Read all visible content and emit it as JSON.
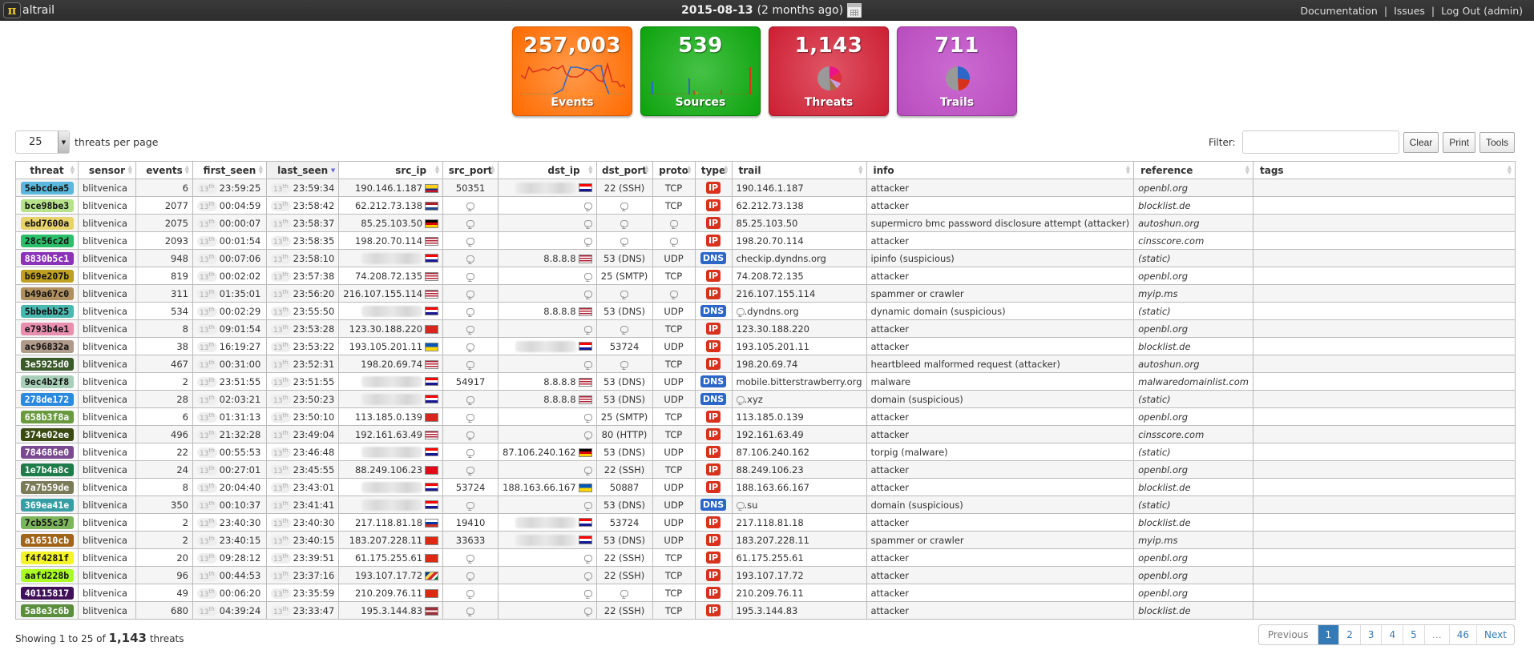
{
  "topbar": {
    "logo_text": "altrail",
    "date": "2015-08-13",
    "date_relative": "(2 months ago)",
    "links": [
      "Documentation",
      "Issues",
      "Log Out (admin)"
    ]
  },
  "cards": [
    {
      "id": "events",
      "value": "257,003",
      "label": "Events",
      "color": "#ff7a1a"
    },
    {
      "id": "sources",
      "value": "539",
      "label": "Sources",
      "color": "#1aab1a"
    },
    {
      "id": "threats",
      "value": "1,143",
      "label": "Threats",
      "color": "#d42f40"
    },
    {
      "id": "trails",
      "value": "711",
      "label": "Trails",
      "color": "#c05cc6"
    }
  ],
  "controls": {
    "per_page_value": "25",
    "per_page_label": "threats per page",
    "filter_label": "Filter:",
    "filter_value": "",
    "clear_label": "Clear",
    "print_label": "Print",
    "tools_label": "Tools"
  },
  "table": {
    "columns": [
      "threat",
      "sensor",
      "events",
      "first_seen",
      "last_seen",
      "src_ip",
      "src_port",
      "dst_ip",
      "dst_port",
      "proto",
      "type",
      "trail",
      "info",
      "reference",
      "tags"
    ],
    "sorted_column": "last_seen",
    "rows": [
      {
        "threat": "5ebcdea5",
        "color": "#5bb8dc",
        "fg": "#111",
        "sensor": "blitvenica",
        "events": "6",
        "day": "13",
        "first": "23:59:25",
        "last": "23:59:34",
        "src_ip": "190.146.1.187",
        "src_flag": "co",
        "src_port": "50351",
        "dst_ip": "blurred",
        "dst_flag": "hr",
        "dst_port": "22 (SSH)",
        "proto": "TCP",
        "type": "IP",
        "trail": "190.146.1.187",
        "info": "attacker",
        "reference": "openbl.org"
      },
      {
        "threat": "bce98be3",
        "color": "#b6e28a",
        "fg": "#111",
        "sensor": "blitvenica",
        "events": "2077",
        "day": "13",
        "first": "00:04:59",
        "last": "23:58:42",
        "src_ip": "62.212.73.138",
        "src_flag": "nl",
        "src_port": "",
        "dst_ip": "",
        "dst_flag": "",
        "dst_port": "",
        "proto": "TCP",
        "type": "IP",
        "trail": "62.212.73.138",
        "info": "attacker",
        "reference": "blocklist.de"
      },
      {
        "threat": "ebd7600a",
        "color": "#e8d36a",
        "fg": "#111",
        "sensor": "blitvenica",
        "events": "2075",
        "day": "13",
        "first": "00:00:07",
        "last": "23:58:37",
        "src_ip": "85.25.103.50",
        "src_flag": "de",
        "src_port": "",
        "dst_ip": "",
        "dst_flag": "",
        "dst_port": "",
        "proto": "",
        "type": "IP",
        "trail": "85.25.103.50",
        "info": "supermicro bmc password disclosure attempt (attacker)",
        "reference": "autoshun.org"
      },
      {
        "threat": "28c56c2d",
        "color": "#2bbf6a",
        "fg": "#111",
        "sensor": "blitvenica",
        "events": "2093",
        "day": "13",
        "first": "00:01:54",
        "last": "23:58:35",
        "src_ip": "198.20.70.114",
        "src_flag": "us",
        "src_port": "",
        "dst_ip": "",
        "dst_flag": "",
        "dst_port": "",
        "proto": "",
        "type": "IP",
        "trail": "198.20.70.114",
        "info": "attacker",
        "reference": "cinsscore.com"
      },
      {
        "threat": "8830b5c1",
        "color": "#8a33b8",
        "fg": "#fff",
        "sensor": "blitvenica",
        "events": "948",
        "day": "13",
        "first": "00:07:06",
        "last": "23:58:10",
        "src_ip": "blurred",
        "src_flag": "hr",
        "src_port": "",
        "dst_ip": "8.8.8.8",
        "dst_flag": "us",
        "dst_port": "53 (DNS)",
        "proto": "UDP",
        "type": "DNS",
        "trail": "checkip.dyndns.org",
        "info": "ipinfo (suspicious)",
        "reference": "(static)"
      },
      {
        "threat": "b69e207b",
        "color": "#c0a020",
        "fg": "#111",
        "sensor": "blitvenica",
        "events": "819",
        "day": "13",
        "first": "00:02:02",
        "last": "23:57:38",
        "src_ip": "74.208.72.135",
        "src_flag": "us",
        "src_port": "",
        "dst_ip": "",
        "dst_flag": "",
        "dst_port": "25 (SMTP)",
        "proto": "TCP",
        "type": "IP",
        "trail": "74.208.72.135",
        "info": "attacker",
        "reference": "openbl.org"
      },
      {
        "threat": "b49a67c0",
        "color": "#b09060",
        "fg": "#111",
        "sensor": "blitvenica",
        "events": "311",
        "day": "13",
        "first": "01:35:01",
        "last": "23:56:20",
        "src_ip": "216.107.155.114",
        "src_flag": "us",
        "src_port": "",
        "dst_ip": "",
        "dst_flag": "",
        "dst_port": "",
        "proto": "",
        "type": "IP",
        "trail": "216.107.155.114",
        "info": "spammer or crawler",
        "reference": "myip.ms"
      },
      {
        "threat": "5bbebb25",
        "color": "#4ab8b0",
        "fg": "#111",
        "sensor": "blitvenica",
        "events": "534",
        "day": "13",
        "first": "00:02:29",
        "last": "23:55:50",
        "src_ip": "blurred",
        "src_flag": "hr",
        "src_port": "",
        "dst_ip": "8.8.8.8",
        "dst_flag": "us",
        "dst_port": "53 (DNS)",
        "proto": "UDP",
        "type": "DNS",
        "trail": "●.dyndns.org",
        "info": "dynamic domain (suspicious)",
        "reference": "(static)"
      },
      {
        "threat": "e793b4e1",
        "color": "#e88fb0",
        "fg": "#111",
        "sensor": "blitvenica",
        "events": "8",
        "day": "13",
        "first": "09:01:54",
        "last": "23:53:28",
        "src_ip": "123.30.188.220",
        "src_flag": "vn",
        "src_port": "",
        "dst_ip": "",
        "dst_flag": "",
        "dst_port": "",
        "proto": "TCP",
        "type": "IP",
        "trail": "123.30.188.220",
        "info": "attacker",
        "reference": "openbl.org"
      },
      {
        "threat": "ac96832a",
        "color": "#b09a8a",
        "fg": "#111",
        "sensor": "blitvenica",
        "events": "38",
        "day": "13",
        "first": "16:19:27",
        "last": "23:53:22",
        "src_ip": "193.105.201.11",
        "src_flag": "ua",
        "src_port": "",
        "dst_ip": "blurred",
        "dst_flag": "hr",
        "dst_port": "53724",
        "proto": "UDP",
        "type": "IP",
        "trail": "193.105.201.11",
        "info": "attacker",
        "reference": "blocklist.de"
      },
      {
        "threat": "3e5925d0",
        "color": "#3a5a2a",
        "fg": "#fff",
        "sensor": "blitvenica",
        "events": "467",
        "day": "13",
        "first": "00:31:00",
        "last": "23:52:31",
        "src_ip": "198.20.69.74",
        "src_flag": "us",
        "src_port": "",
        "dst_ip": "",
        "dst_flag": "",
        "dst_port": "",
        "proto": "TCP",
        "type": "IP",
        "trail": "198.20.69.74",
        "info": "heartbleed malformed request (attacker)",
        "reference": "autoshun.org"
      },
      {
        "threat": "9ec4b2f8",
        "color": "#a8d0b8",
        "fg": "#111",
        "sensor": "blitvenica",
        "events": "2",
        "day": "13",
        "first": "23:51:55",
        "last": "23:51:55",
        "src_ip": "blurred",
        "src_flag": "hr",
        "src_port": "54917",
        "dst_ip": "8.8.8.8",
        "dst_flag": "us",
        "dst_port": "53 (DNS)",
        "proto": "UDP",
        "type": "DNS",
        "trail": "mobile.bitterstrawberry.org",
        "info": "malware",
        "reference": "malwaredomainlist.com"
      },
      {
        "threat": "278de172",
        "color": "#2a8ae0",
        "fg": "#fff",
        "sensor": "blitvenica",
        "events": "28",
        "day": "13",
        "first": "02:03:21",
        "last": "23:50:23",
        "src_ip": "blurred",
        "src_flag": "hr",
        "src_port": "",
        "dst_ip": "8.8.8.8",
        "dst_flag": "us",
        "dst_port": "53 (DNS)",
        "proto": "UDP",
        "type": "DNS",
        "trail": "●.xyz",
        "info": "domain (suspicious)",
        "reference": "(static)"
      },
      {
        "threat": "658b3f8a",
        "color": "#6a9a40",
        "fg": "#fff",
        "sensor": "blitvenica",
        "events": "6",
        "day": "13",
        "first": "01:31:13",
        "last": "23:50:10",
        "src_ip": "113.185.0.139",
        "src_flag": "vn",
        "src_port": "",
        "dst_ip": "",
        "dst_flag": "",
        "dst_port": "25 (SMTP)",
        "proto": "TCP",
        "type": "IP",
        "trail": "113.185.0.139",
        "info": "attacker",
        "reference": "openbl.org"
      },
      {
        "threat": "374e02ee",
        "color": "#3a4a10",
        "fg": "#fff",
        "sensor": "blitvenica",
        "events": "496",
        "day": "13",
        "first": "21:32:28",
        "last": "23:49:04",
        "src_ip": "192.161.63.49",
        "src_flag": "us",
        "src_port": "",
        "dst_ip": "",
        "dst_flag": "",
        "dst_port": "80 (HTTP)",
        "proto": "TCP",
        "type": "IP",
        "trail": "192.161.63.49",
        "info": "attacker",
        "reference": "cinsscore.com"
      },
      {
        "threat": "784686e0",
        "color": "#7a4a90",
        "fg": "#fff",
        "sensor": "blitvenica",
        "events": "22",
        "day": "13",
        "first": "00:55:53",
        "last": "23:46:48",
        "src_ip": "blurred",
        "src_flag": "hr",
        "src_port": "",
        "dst_ip": "87.106.240.162",
        "dst_flag": "de",
        "dst_port": "53 (DNS)",
        "proto": "UDP",
        "type": "IP",
        "trail": "87.106.240.162",
        "info": "torpig (malware)",
        "reference": "(static)"
      },
      {
        "threat": "1e7b4a8c",
        "color": "#1e7b4a",
        "fg": "#fff",
        "sensor": "blitvenica",
        "events": "24",
        "day": "13",
        "first": "00:27:01",
        "last": "23:45:55",
        "src_ip": "88.249.106.23",
        "src_flag": "tr",
        "src_port": "",
        "dst_ip": "",
        "dst_flag": "",
        "dst_port": "22 (SSH)",
        "proto": "TCP",
        "type": "IP",
        "trail": "88.249.106.23",
        "info": "attacker",
        "reference": "openbl.org"
      },
      {
        "threat": "7a7b59de",
        "color": "#7a7b59",
        "fg": "#fff",
        "sensor": "blitvenica",
        "events": "8",
        "day": "13",
        "first": "20:04:40",
        "last": "23:43:01",
        "src_ip": "blurred",
        "src_flag": "hr",
        "src_port": "53724",
        "dst_ip": "188.163.66.167",
        "dst_flag": "ua",
        "dst_port": "50887",
        "proto": "UDP",
        "type": "IP",
        "trail": "188.163.66.167",
        "info": "attacker",
        "reference": "blocklist.de"
      },
      {
        "threat": "369ea41e",
        "color": "#369ea4",
        "fg": "#fff",
        "sensor": "blitvenica",
        "events": "350",
        "day": "13",
        "first": "00:10:37",
        "last": "23:41:41",
        "src_ip": "blurred",
        "src_flag": "hr",
        "src_port": "",
        "dst_ip": "",
        "dst_flag": "",
        "dst_port": "53 (DNS)",
        "proto": "UDP",
        "type": "DNS",
        "trail": "●.su",
        "info": "domain (suspicious)",
        "reference": "(static)"
      },
      {
        "threat": "7cb55c37",
        "color": "#7cb55c",
        "fg": "#111",
        "sensor": "blitvenica",
        "events": "2",
        "day": "13",
        "first": "23:40:30",
        "last": "23:40:30",
        "src_ip": "217.118.81.18",
        "src_flag": "ru",
        "src_port": "19410",
        "dst_ip": "blurred",
        "dst_flag": "hr",
        "dst_port": "53724",
        "proto": "UDP",
        "type": "IP",
        "trail": "217.118.81.18",
        "info": "attacker",
        "reference": "blocklist.de"
      },
      {
        "threat": "a16510cb",
        "color": "#a1651a",
        "fg": "#fff",
        "sensor": "blitvenica",
        "events": "2",
        "day": "13",
        "first": "23:40:15",
        "last": "23:40:15",
        "src_ip": "183.207.228.11",
        "src_flag": "cn",
        "src_port": "33633",
        "dst_ip": "blurred",
        "dst_flag": "hr",
        "dst_port": "53 (DNS)",
        "proto": "UDP",
        "type": "IP",
        "trail": "183.207.228.11",
        "info": "spammer or crawler",
        "reference": "myip.ms"
      },
      {
        "threat": "f4f4281f",
        "color": "#f4f428",
        "fg": "#111",
        "sensor": "blitvenica",
        "events": "20",
        "day": "13",
        "first": "09:28:12",
        "last": "23:39:51",
        "src_ip": "61.175.255.61",
        "src_flag": "cn",
        "src_port": "",
        "dst_ip": "",
        "dst_flag": "",
        "dst_port": "22 (SSH)",
        "proto": "TCP",
        "type": "IP",
        "trail": "61.175.255.61",
        "info": "attacker",
        "reference": "openbl.org"
      },
      {
        "threat": "aafd228b",
        "color": "#aafd22",
        "fg": "#111",
        "sensor": "blitvenica",
        "events": "96",
        "day": "13",
        "first": "00:44:53",
        "last": "23:37:16",
        "src_ip": "193.107.17.72",
        "src_flag": "sc",
        "src_port": "",
        "dst_ip": "",
        "dst_flag": "",
        "dst_port": "22 (SSH)",
        "proto": "TCP",
        "type": "IP",
        "trail": "193.107.17.72",
        "info": "attacker",
        "reference": "openbl.org"
      },
      {
        "threat": "40115817",
        "color": "#401158",
        "fg": "#fff",
        "sensor": "blitvenica",
        "events": "49",
        "day": "13",
        "first": "00:06:20",
        "last": "23:35:59",
        "src_ip": "210.209.76.11",
        "src_flag": "hk",
        "src_port": "",
        "dst_ip": "",
        "dst_flag": "",
        "dst_port": "",
        "proto": "TCP",
        "type": "IP",
        "trail": "210.209.76.11",
        "info": "attacker",
        "reference": "openbl.org"
      },
      {
        "threat": "5a8e3c6b",
        "color": "#5a8e3c",
        "fg": "#fff",
        "sensor": "blitvenica",
        "events": "680",
        "day": "13",
        "first": "04:39:24",
        "last": "23:33:47",
        "src_ip": "195.3.144.83",
        "src_flag": "lv",
        "src_port": "",
        "dst_ip": "",
        "dst_flag": "",
        "dst_port": "22 (SSH)",
        "proto": "TCP",
        "type": "IP",
        "trail": "195.3.144.83",
        "info": "attacker",
        "reference": "blocklist.de"
      }
    ]
  },
  "footer": {
    "showing_prefix": "Showing 1 to 25 of",
    "total": "1,143",
    "showing_suffix": "threats",
    "pagination": [
      "Previous",
      "1",
      "2",
      "3",
      "4",
      "5",
      "…",
      "46",
      "Next"
    ],
    "active_page": "1"
  }
}
